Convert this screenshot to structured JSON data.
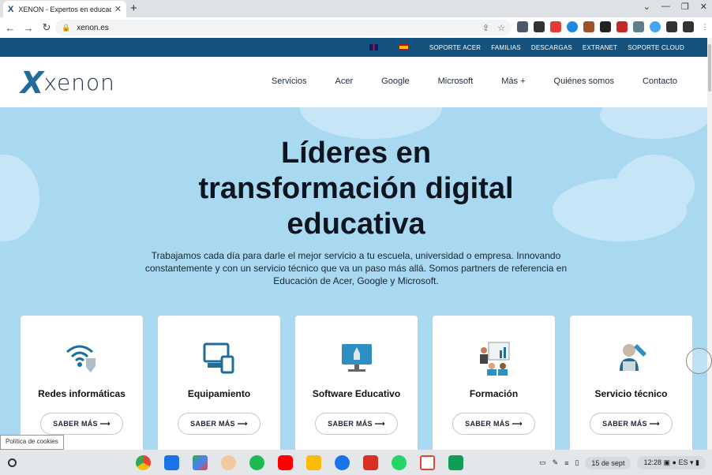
{
  "browser": {
    "tab_title": "XENON - Expertos en educació",
    "tab_favicon": "X",
    "url": "xenon.es"
  },
  "site": {
    "topbar_links": [
      "SOPORTE ACER",
      "FAMILIAS",
      "DESCARGAS",
      "EXTRANET",
      "SOPORTE CLOUD"
    ],
    "logo_mark": "X",
    "logo_text": "xenon",
    "nav": [
      "Servicios",
      "Acer",
      "Google",
      "Microsoft",
      "Más +",
      "Quiénes somos",
      "Contacto"
    ],
    "hero_title": "Líderes en transformación digital educativa",
    "hero_lead": "Trabajamos cada día para darle el mejor servicio a tu escuela, universidad o empresa. Innovando constantemente y con un servicio técnico que va un paso más allá. Somos partners de referencia en Educación de Acer, Google y Microsoft.",
    "cards": [
      {
        "title": "Redes informáticas",
        "button": "SABER MÁS ⟶",
        "icon": "wifi-shield-icon"
      },
      {
        "title": "Equipamiento",
        "button": "SABER MÁS ⟶",
        "icon": "devices-icon"
      },
      {
        "title": "Software Educativo",
        "button": "SABER MÁS ⟶",
        "icon": "monitor-rocket-icon"
      },
      {
        "title": "Formación",
        "button": "SABER MÁS ⟶",
        "icon": "training-board-icon"
      },
      {
        "title": "Servicio técnico",
        "button": "SABER MÁS ⟶",
        "icon": "technician-icon"
      }
    ],
    "cookie_label": "Política de cookies"
  },
  "shelf": {
    "date": "15 de sept",
    "time": "12:28",
    "lang": "ES"
  },
  "colors": {
    "topbar": "#15537e",
    "hero_bg": "#a9d8f1",
    "accent": "#1f6e9a"
  }
}
